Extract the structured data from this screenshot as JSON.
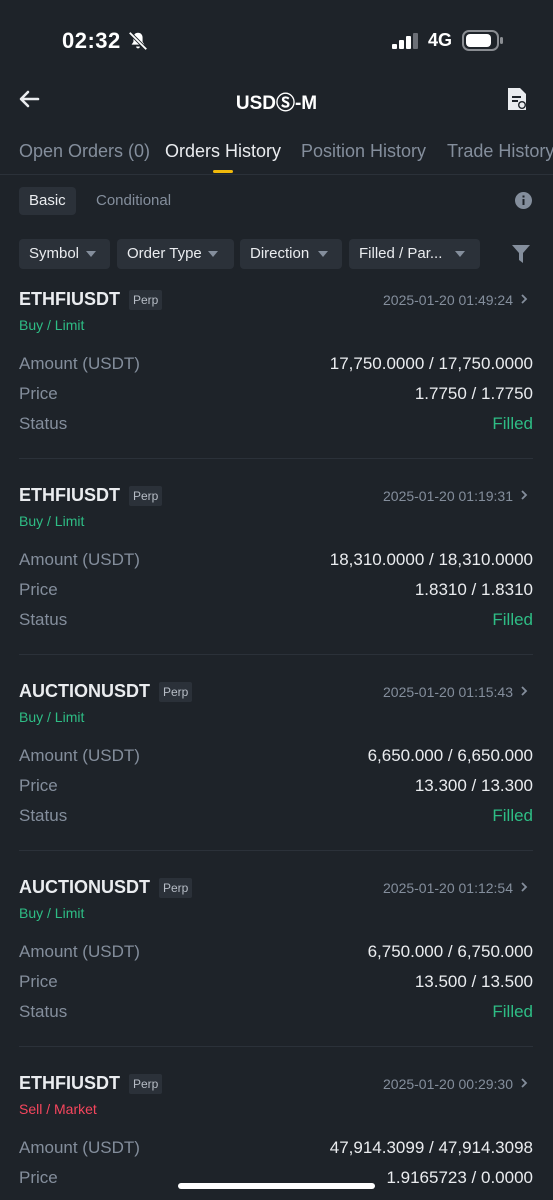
{
  "status_bar": {
    "time": "02:32",
    "network": "4G"
  },
  "nav": {
    "title": "USDⓈ-M"
  },
  "tabs": [
    {
      "label": "Open Orders (0)"
    },
    {
      "label": "Orders History"
    },
    {
      "label": "Position History"
    },
    {
      "label": "Trade History"
    }
  ],
  "active_tab": "Orders History",
  "subtabs": [
    {
      "label": "Basic"
    },
    {
      "label": "Conditional"
    }
  ],
  "filters": [
    {
      "label": "Symbol"
    },
    {
      "label": "Order Type"
    },
    {
      "label": "Direction"
    },
    {
      "label": "Filled / Par..."
    }
  ],
  "row_labels": {
    "amount": "Amount (USDT)",
    "price": "Price",
    "status": "Status"
  },
  "orders": [
    {
      "symbol": "ETHFIUSDT",
      "badge": "Perp",
      "time": "2025-01-20 01:49:24",
      "side": "Buy / Limit",
      "amount": "17,750.0000 / 17,750.0000",
      "price": "1.7750 / 1.7750",
      "status": "Filled"
    },
    {
      "symbol": "ETHFIUSDT",
      "badge": "Perp",
      "time": "2025-01-20 01:19:31",
      "side": "Buy / Limit",
      "amount": "18,310.0000 / 18,310.0000",
      "price": "1.8310 / 1.8310",
      "status": "Filled"
    },
    {
      "symbol": "AUCTIONUSDT",
      "badge": "Perp",
      "time": "2025-01-20 01:15:43",
      "side": "Buy / Limit",
      "amount": "6,650.000 / 6,650.000",
      "price": "13.300 / 13.300",
      "status": "Filled"
    },
    {
      "symbol": "AUCTIONUSDT",
      "badge": "Perp",
      "time": "2025-01-20 01:12:54",
      "side": "Buy / Limit",
      "amount": "6,750.000 / 6,750.000",
      "price": "13.500 / 13.500",
      "status": "Filled"
    },
    {
      "symbol": "ETHFIUSDT",
      "badge": "Perp",
      "time": "2025-01-20 00:29:30",
      "side": "Sell / Market",
      "amount": "47,914.3099 / 47,914.3098",
      "price": "1.9165723 / 0.0000",
      "status": ""
    }
  ],
  "colors": {
    "background": "#1e2329",
    "buy": "#2ebd85",
    "sell": "#f6465d",
    "accent": "#f0b90b",
    "muted": "#848e9c"
  },
  "icons": [
    "mute-bell-icon",
    "signal-icon",
    "battery-icon",
    "back-arrow-icon",
    "document-icon",
    "info-icon",
    "funnel-icon",
    "chevron-right-icon",
    "caret-down-icon"
  ]
}
